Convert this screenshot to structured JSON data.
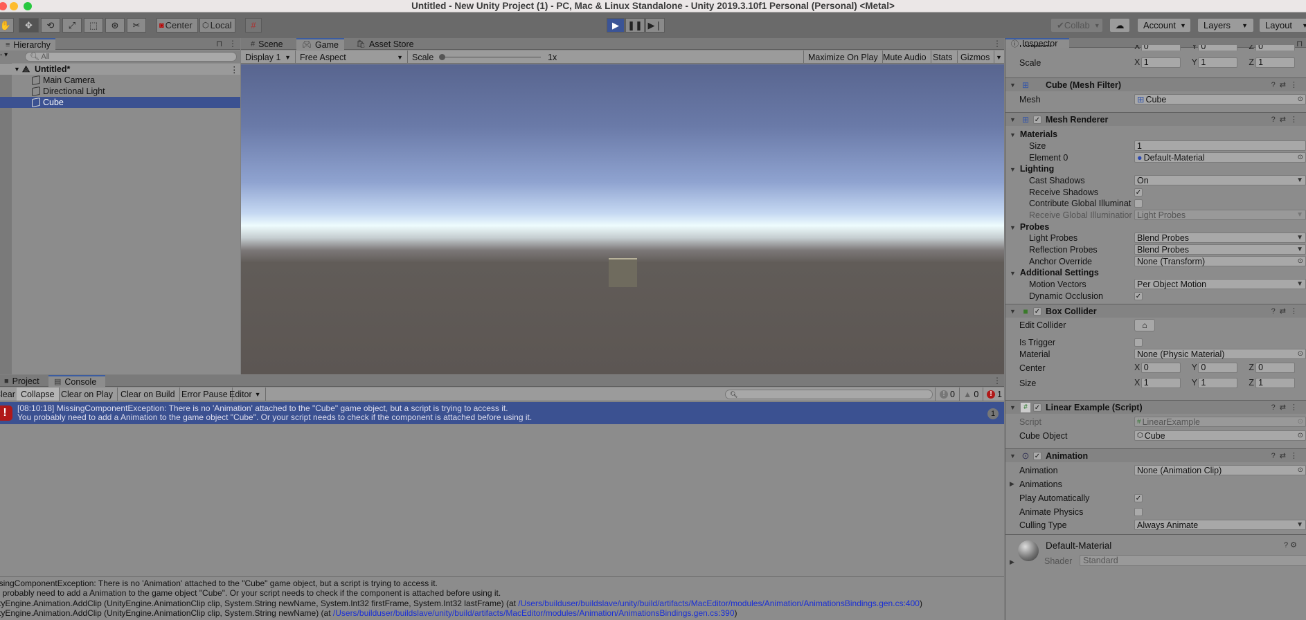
{
  "window": {
    "title": "Untitled - New Unity Project (1) - PC, Mac & Linux Standalone - Unity 2019.3.10f1 Personal (Personal) <Metal>"
  },
  "toolbar": {
    "tools": [
      "hand-tool",
      "move-tool",
      "rotate-tool",
      "scale-tool",
      "rect-tool",
      "transform-tool",
      "custom-tool"
    ],
    "pivot_label": "Center",
    "space_label": "Local",
    "collab_label": "Collab",
    "account_label": "Account",
    "layers_label": "Layers",
    "layout_label": "Layout"
  },
  "hierarchy": {
    "tab_label": "Hierarchy",
    "search_placeholder": "All",
    "scene_name": "Untitled*",
    "items": [
      {
        "label": "Main Camera",
        "selected": false
      },
      {
        "label": "Directional Light",
        "selected": false
      },
      {
        "label": "Cube",
        "selected": true
      }
    ]
  },
  "center_tabs": [
    {
      "label": "Scene",
      "icon": "#"
    },
    {
      "label": "Game",
      "icon": "gamepad"
    },
    {
      "label": "Asset Store",
      "icon": "bag"
    }
  ],
  "game_toolbar": {
    "display": "Display 1",
    "aspect": "Free Aspect",
    "scale_label": "Scale",
    "scale_value": "1x",
    "maximize": "Maximize On Play",
    "mute": "Mute Audio",
    "stats": "Stats",
    "gizmos": "Gizmos"
  },
  "bottom_tabs": [
    {
      "label": "Project"
    },
    {
      "label": "Console"
    }
  ],
  "console": {
    "buttons": [
      "Clear",
      "Collapse",
      "Clear on Play",
      "Clear on Build",
      "Error Pause",
      "Editor"
    ],
    "counts": {
      "info": "0",
      "warning": "0",
      "error": "1"
    },
    "entry": {
      "line1": "[08:10:18] MissingComponentException: There is no 'Animation' attached to the \"Cube\" game object, but a script is trying to access it.",
      "line2": "You probably need to add a Animation to the game object \"Cube\". Or your script needs to check if the component is attached before using it.",
      "count": "1"
    },
    "detail": {
      "line1": "MissingComponentException: There is no 'Animation' attached to the \"Cube\" game object, but a script is trying to access it.",
      "line2": "You probably need to add a Animation to the game object \"Cube\". Or your script needs to check if the component is attached before using it.",
      "line3_prefix": "UnityEngine.Animation.AddClip (UnityEngine.AnimationClip clip, System.String newName, System.Int32 firstFrame, System.Int32 lastFrame) (at ",
      "line3_link": "/Users/builduser/buildslave/unity/build/artifacts/MacEditor/modules/Animation/AnimationsBindings.gen.cs:400",
      "line4_prefix": "UnityEngine.Animation.AddClip (UnityEngine.AnimationClip clip, System.String newName) (at ",
      "line4_link": "/Users/builduser/buildslave/unity/build/artifacts/MacEditor/modules/Animation/AnimationsBindings.gen.cs:390",
      "close": ")"
    }
  },
  "inspector": {
    "tab_label": "Inspector",
    "transform": {
      "rotation_label": "Rotation",
      "rotation": [
        "0",
        "0",
        "0"
      ],
      "scale_label": "Scale",
      "scale": [
        "1",
        "1",
        "1"
      ]
    },
    "mesh_filter": {
      "title": "Cube (Mesh Filter)",
      "mesh_label": "Mesh",
      "mesh_value": "Cube"
    },
    "mesh_renderer": {
      "title": "Mesh Renderer",
      "materials": "Materials",
      "size_label": "Size",
      "size_value": "1",
      "element0_label": "Element 0",
      "element0_value": "Default-Material",
      "lighting": "Lighting",
      "cast_shadows_label": "Cast Shadows",
      "cast_shadows_value": "On",
      "receive_shadows_label": "Receive Shadows",
      "receive_shadows": true,
      "contribute_gi_label": "Contribute Global Illuminat",
      "contribute_gi": false,
      "receive_gi_label": "Receive Global Illuminatior",
      "receive_gi_value": "Light Probes",
      "probes": "Probes",
      "light_probes_label": "Light Probes",
      "light_probes_value": "Blend Probes",
      "reflection_probes_label": "Reflection Probes",
      "reflection_probes_value": "Blend Probes",
      "anchor_override_label": "Anchor Override",
      "anchor_override_value": "None (Transform)",
      "additional": "Additional Settings",
      "motion_vectors_label": "Motion Vectors",
      "motion_vectors_value": "Per Object Motion",
      "dynamic_occlusion_label": "Dynamic Occlusion",
      "dynamic_occlusion": true
    },
    "box_collider": {
      "title": "Box Collider",
      "edit_label": "Edit Collider",
      "is_trigger_label": "Is Trigger",
      "is_trigger": false,
      "material_label": "Material",
      "material_value": "None (Physic Material)",
      "center_label": "Center",
      "center": [
        "0",
        "0",
        "0"
      ],
      "size_label": "Size",
      "size": [
        "1",
        "1",
        "1"
      ]
    },
    "script": {
      "title": "Linear Example (Script)",
      "script_label": "Script",
      "script_value": "LinearExample",
      "cube_label": "Cube Object",
      "cube_value": "Cube"
    },
    "animation": {
      "title": "Animation",
      "animation_label": "Animation",
      "animation_value": "None (Animation Clip)",
      "animations_label": "Animations",
      "play_auto_label": "Play Automatically",
      "play_auto": true,
      "animate_physics_label": "Animate Physics",
      "animate_physics": false,
      "culling_label": "Culling Type",
      "culling_value": "Always Animate"
    },
    "material": {
      "name": "Default-Material",
      "shader_label": "Shader",
      "shader_value": "Standard"
    }
  },
  "colors": {
    "selection": "#3b5191",
    "play_active": "#3b5496",
    "link": "#1a2fd6",
    "error_red": "#b01818"
  }
}
